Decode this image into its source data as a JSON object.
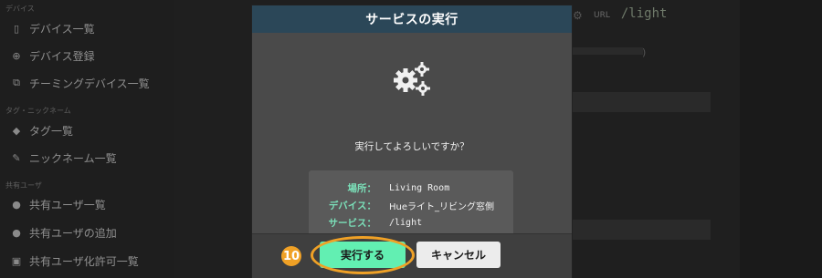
{
  "sidebar": {
    "sections": [
      {
        "title": "デバイス"
      },
      {
        "title": "タグ・ニックネーム"
      },
      {
        "title": "共有ユーザ"
      }
    ],
    "items": [
      {
        "label": "デバイス一覧",
        "icon": "tablet-icon"
      },
      {
        "label": "デバイス登録",
        "icon": "plus-circle-icon"
      },
      {
        "label": "チーミングデバイス一覧",
        "icon": "copy-icon"
      },
      {
        "label": "タグ一覧",
        "icon": "tags-icon"
      },
      {
        "label": "ニックネーム一覧",
        "icon": "pencil-icon"
      },
      {
        "label": "共有ユーザ一覧",
        "icon": "user-icon"
      },
      {
        "label": "共有ユーザの追加",
        "icon": "user-plus-icon"
      },
      {
        "label": "共有ユーザ化許可一覧",
        "icon": "unlock-icon"
      }
    ]
  },
  "background": {
    "url_label": "URL",
    "url_value": "/light",
    "paren": ")"
  },
  "modal": {
    "title": "サービスの実行",
    "confirm_text": "実行してよろしいですか？",
    "details": [
      {
        "key": "場所：",
        "value": "Living Room"
      },
      {
        "key": "デバイス：",
        "value": "Hueライト_リビング窓側"
      },
      {
        "key": "サービス：",
        "value": "/light"
      }
    ],
    "execute_label": "実行する",
    "cancel_label": "キャンセル",
    "step_number": "10"
  },
  "colors": {
    "header": "#2b4758",
    "accent": "#62efb2",
    "key_text": "#7be0b9",
    "highlight": "#f0a126"
  }
}
